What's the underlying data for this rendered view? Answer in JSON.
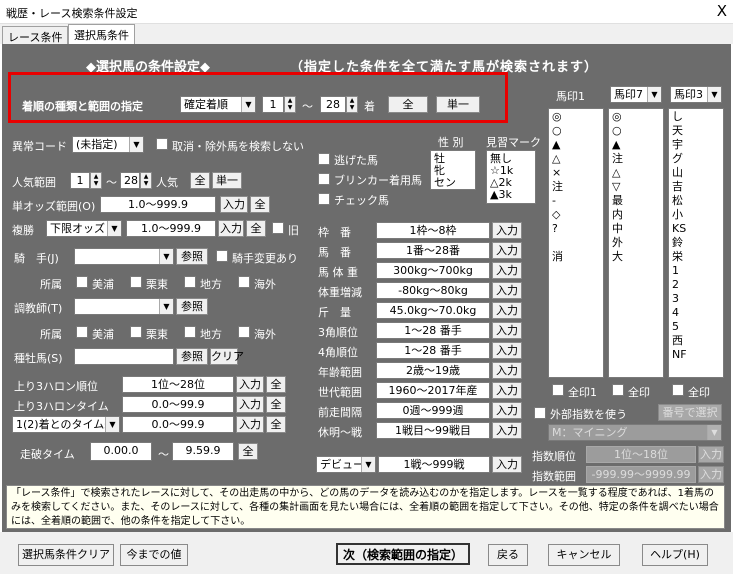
{
  "window": {
    "title": "戦歴・レース検索条件設定",
    "close": "X"
  },
  "tabs": [
    "レース条件",
    "選択馬条件"
  ],
  "header": {
    "left": "◆選択馬の条件設定◆",
    "right": "（指定した条件を全て満たす馬が検索されます）"
  },
  "order": {
    "label": "着順の種類と範囲の指定",
    "type": "確定着順",
    "from": "1",
    "sep": "～",
    "to": "28",
    "unit": "着",
    "all_btn": "全",
    "single_btn": "単一"
  },
  "ijo": {
    "label": "異常コード",
    "value": "(未指定)",
    "chk": "取消・除外馬を検索しない"
  },
  "sex": {
    "label": "性 別",
    "items": [
      "牡",
      "牝",
      "セン"
    ]
  },
  "minarai": {
    "label": "見習マーク",
    "items": [
      "無し",
      "☆1k",
      "△2k",
      "▲3k"
    ]
  },
  "flags": [
    "逃げた馬",
    "ブリンカー着用馬",
    "チェック馬"
  ],
  "ninki": {
    "label": "人気範囲",
    "from": "1",
    "to": "28",
    "unit": "人気",
    "all": "全",
    "single": "単一"
  },
  "tanodds": {
    "label": "単オッズ範囲(O)",
    "value": "1.0～999.9",
    "input": "入力",
    "all": "全"
  },
  "fukusho": {
    "label": "複勝",
    "type": "下限オッズ",
    "value": "1.0～999.9",
    "input": "入力",
    "all": "全",
    "old": "旧"
  },
  "jockey": {
    "label": "騎　手(J)",
    "ref": "参照",
    "chg": "騎手変更あり"
  },
  "affil": {
    "label": "所属",
    "items": [
      "美浦",
      "栗東",
      "地方",
      "海外"
    ]
  },
  "trainer": {
    "label": "調教師(T)",
    "ref": "参照"
  },
  "sire": {
    "label": "種牡馬(S)",
    "ref": "参照",
    "clear": "クリア"
  },
  "agari": [
    {
      "label": "上り3ハロン順位",
      "value": "1位～28位",
      "input": "入力",
      "all": "全"
    },
    {
      "label": "上り3ハロンタイム",
      "value": "0.0～99.9",
      "input": "入力",
      "all": "全"
    },
    {
      "label": "1(2)着とのタイム差",
      "value": "0.0～99.9",
      "input": "入力",
      "all": "全"
    }
  ],
  "hasha": {
    "label": "走破タイム",
    "from": "0.00.0",
    "sep": "～",
    "to": "9.59.9",
    "all": "全"
  },
  "ranges": [
    {
      "label": "枠　番",
      "value": "1枠～8枠",
      "input": "入力"
    },
    {
      "label": "馬　番",
      "value": "1番～28番",
      "input": "入力"
    },
    {
      "label": "馬 体 重",
      "value": "300kg～700kg",
      "input": "入力"
    },
    {
      "label": "体重増減",
      "value": "-80kg～80kg",
      "input": "入力"
    },
    {
      "label": "斤　量",
      "value": "45.0kg～70.0kg",
      "input": "入力"
    },
    {
      "label": "3角順位",
      "value": "1～28 番手",
      "input": "入力"
    },
    {
      "label": "4角順位",
      "value": "1～28 番手",
      "input": "入力"
    },
    {
      "label": "年齢範囲",
      "value": "2歳～19歳",
      "input": "入力"
    },
    {
      "label": "世代範囲",
      "value": "1960～2017年産",
      "input": "入力"
    },
    {
      "label": "前走間隔",
      "value": "0週～999週",
      "input": "入力"
    },
    {
      "label": "休明～戦",
      "value": "1戦目～99戦目",
      "input": "入力"
    }
  ],
  "debut": {
    "type": "デビュー",
    "value": "1戦～999戦",
    "input": "入力"
  },
  "marks": {
    "cols": [
      "馬印1",
      "馬印7",
      "馬印3"
    ],
    "list1": [
      "◎",
      "○",
      "▲",
      "△",
      "×",
      "注",
      "-",
      "◇",
      "?",
      "",
      "消"
    ],
    "list2": [
      "◎",
      "○",
      "▲",
      "注",
      "△",
      "▽",
      "最",
      "内",
      "中",
      "外",
      "大"
    ],
    "list3": [
      "し",
      "天",
      "宇",
      "グ",
      "山",
      "吉",
      "松",
      "小",
      "KS",
      "鈴",
      "栄",
      "1",
      "2",
      "3",
      "4",
      "5",
      "西",
      "NF"
    ],
    "all1": "全印1",
    "all2": "全印",
    "all3": "全印"
  },
  "ext": {
    "label": "外部指数を使う",
    "order_btn": "番号で選択",
    "source": "M：マイニング",
    "r1_label": "指数順位",
    "r1": "1位～18位",
    "r2_label": "指数範囲",
    "r2": "-999.99～9999.99",
    "input": "入力"
  },
  "message": "「レース条件」で検索されたレースに対して、その出走馬の中から、どの馬のデータを読み込むのかを指定します。レースを一覧する程度であれば、1着馬のみを検索してください。また、そのレースに対して、各種の集計画面を見たい場合には、全着順の範囲を指定して下さい。その他、特定の条件を調べたい場合には、全着順の範囲で、他の条件を指定して下さい。",
  "buttons": {
    "clear": "選択馬条件クリア",
    "prev": "今までの値",
    "next": "次（検索範囲の指定）",
    "back": "戻る",
    "cancel": "キャンセル",
    "help": "ヘルプ(H)"
  }
}
